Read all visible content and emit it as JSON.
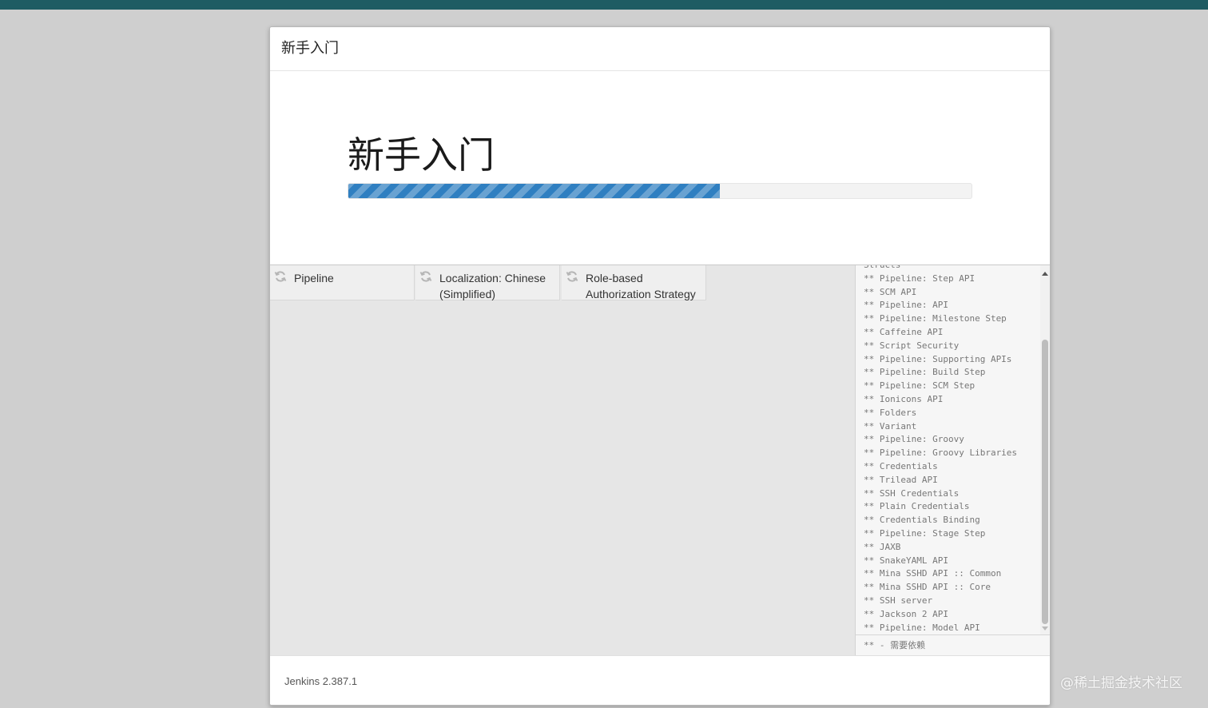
{
  "dialog": {
    "title": "新手入门"
  },
  "hero": {
    "title": "新手入门",
    "progress_percent": 59.6
  },
  "plugins": [
    {
      "label": "Pipeline",
      "icon": "refresh-icon"
    },
    {
      "label": "Localization: Chinese (Simplified)",
      "icon": "refresh-icon"
    },
    {
      "label": "Role-based Authorization Strategy",
      "icon": "refresh-icon"
    }
  ],
  "log": {
    "partial_top": "Structs",
    "lines": [
      "** Pipeline: Step API",
      "** SCM API",
      "** Pipeline: API",
      "** Pipeline: Milestone Step",
      "** Caffeine API",
      "** Script Security",
      "** Pipeline: Supporting APIs",
      "** Pipeline: Build Step",
      "** Pipeline: SCM Step",
      "** Ionicons API",
      "** Folders",
      "** Variant",
      "** Pipeline: Groovy",
      "** Pipeline: Groovy Libraries",
      "** Credentials",
      "** Trilead API",
      "** SSH Credentials",
      "** Plain Credentials",
      "** Credentials Binding",
      "** Pipeline: Stage Step",
      "** JAXB",
      "** SnakeYAML API",
      "** Mina SSHD API :: Common",
      "** Mina SSHD API :: Core",
      "** SSH server",
      "** Jackson 2 API",
      "** Pipeline: Model API"
    ],
    "footer": "** - 需要依赖"
  },
  "footer": {
    "version": "Jenkins 2.387.1"
  },
  "watermark": "@稀土掘金技术社区",
  "colors": {
    "topbar": "#1e5c63",
    "progress": "#2f7fc1"
  }
}
